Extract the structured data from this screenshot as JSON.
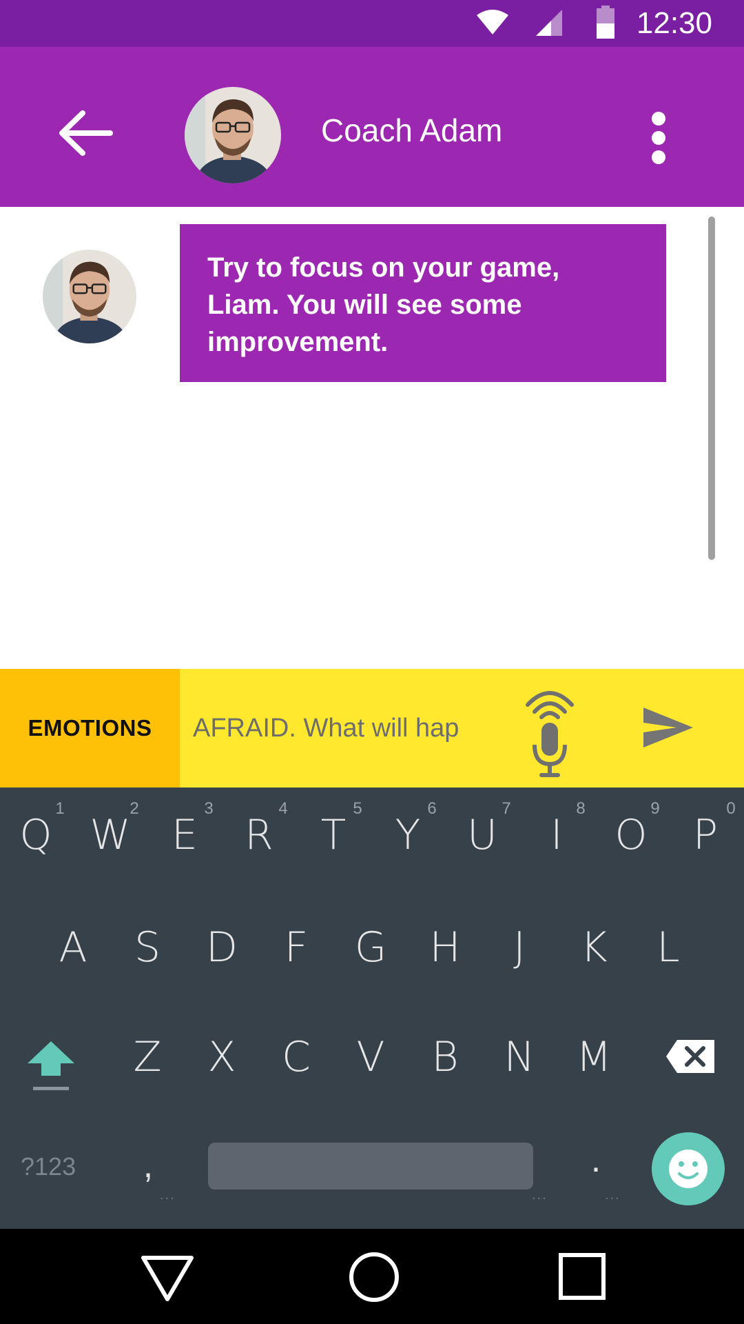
{
  "status_bar": {
    "time": "12:30",
    "icons": [
      "wifi-icon",
      "signal-icon",
      "battery-icon"
    ]
  },
  "header": {
    "title": "Coach Adam",
    "back_icon": "arrow-back-icon",
    "menu_icon": "more-vert-icon"
  },
  "chat": {
    "messages": [
      {
        "sender": "Coach Adam",
        "text": "Try to focus on your game, Liam. You will see some improvement."
      }
    ]
  },
  "composer": {
    "emotions_label": "EMOTIONS",
    "input_value": "AFRAID. What will hap",
    "mic_icon": "mic-icon",
    "send_icon": "send-icon"
  },
  "keyboard": {
    "row1": [
      "Q",
      "W",
      "E",
      "R",
      "T",
      "Y",
      "U",
      "I",
      "O",
      "P"
    ],
    "row1_hints": [
      "1",
      "2",
      "3",
      "4",
      "5",
      "6",
      "7",
      "8",
      "9",
      "0"
    ],
    "row2": [
      "A",
      "S",
      "D",
      "F",
      "G",
      "H",
      "J",
      "K",
      "L"
    ],
    "row3": [
      "Z",
      "X",
      "C",
      "V",
      "B",
      "N",
      "M"
    ],
    "symbols_label": "?123",
    "comma": ",",
    "period": ".",
    "shift_icon": "shift-icon",
    "backspace_icon": "backspace-icon",
    "emoji_icon": "emoji-icon"
  },
  "nav_bar": {
    "icons": [
      "back-triangle-icon",
      "home-circle-icon",
      "recents-square-icon"
    ]
  },
  "colors": {
    "status_bar": "#7b1fa2",
    "primary": "#9c27b0",
    "emotions": "#ffc107",
    "input_bar": "#ffe82e",
    "keyboard": "#37414a",
    "accent": "#63c9b9"
  }
}
